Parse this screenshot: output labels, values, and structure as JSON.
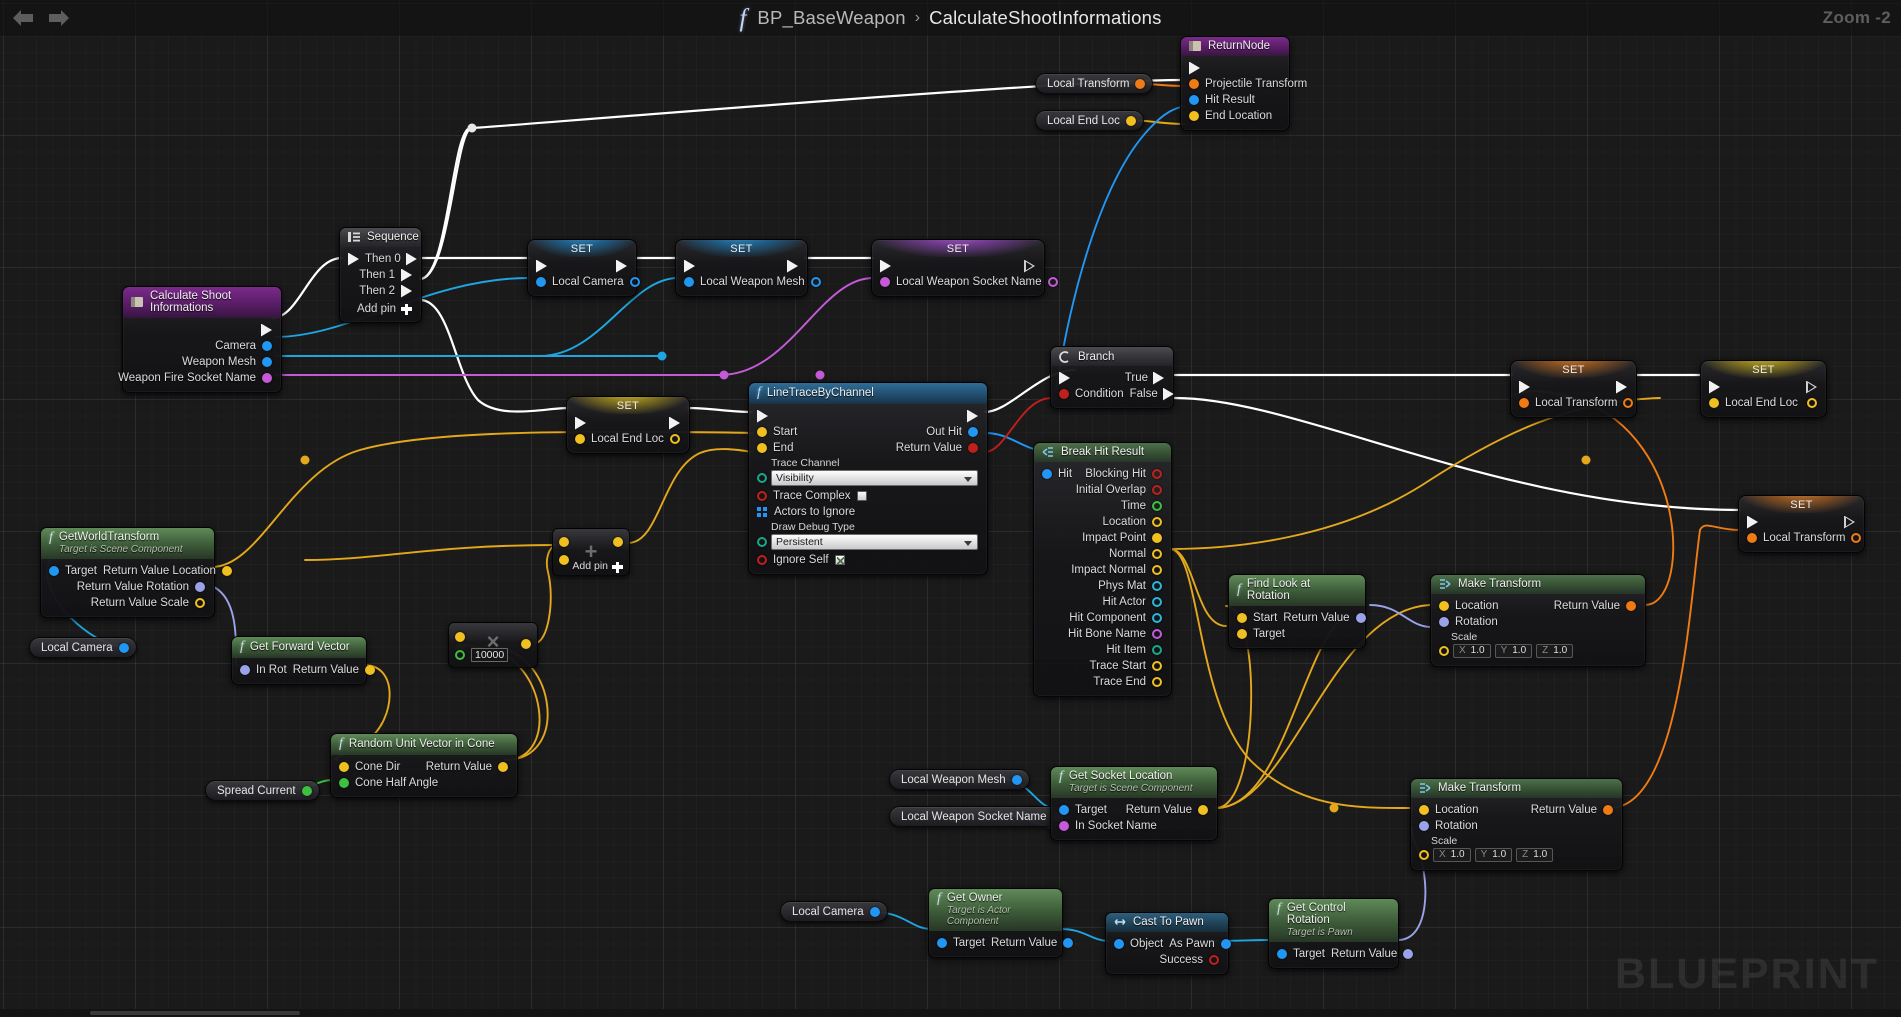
{
  "toolbar": {
    "back_icon": "arrow-left-icon",
    "forward_icon": "arrow-right-icon",
    "function_glyph": "f",
    "blueprint_name": "BP_BaseWeapon",
    "separator": "›",
    "function_name": "CalculateShootInformations",
    "zoom_label": "Zoom -2"
  },
  "watermark": "BLUEPRINT",
  "nodes": {
    "entry": {
      "title": "Calculate Shoot Informations",
      "pins": [
        "Camera",
        "Weapon Mesh",
        "Weapon Fire Socket Name"
      ]
    },
    "sequence": {
      "title": "Sequence",
      "outputs": [
        "Then 0",
        "Then 1",
        "Then 2"
      ],
      "add_pin": "Add pin"
    },
    "set_local_camera": {
      "title": "SET",
      "pin": "Local Camera"
    },
    "set_local_weapon_mesh": {
      "title": "SET",
      "pin": "Local Weapon Mesh"
    },
    "set_local_weapon_socket_name": {
      "title": "SET",
      "pin": "Local Weapon Socket Name"
    },
    "set_local_end_loc_mid": {
      "title": "SET",
      "pin": "Local End Loc"
    },
    "set_local_transform_r1": {
      "title": "SET",
      "pin": "Local Transform"
    },
    "set_local_end_loc_r1": {
      "title": "SET",
      "pin": "Local End Loc"
    },
    "set_local_transform_r2": {
      "title": "SET",
      "pin": "Local Transform"
    },
    "return_node": {
      "title": "ReturnNode",
      "pins": [
        "Projectile Transform",
        "Hit Result",
        "End Location"
      ]
    },
    "line_trace": {
      "title": "LineTraceByChannel",
      "inputs": [
        "Start",
        "End"
      ],
      "outputs": [
        "Out Hit",
        "Return Value"
      ],
      "trace_channel_label": "Trace Channel",
      "trace_channel_value": "Visibility",
      "trace_complex_label": "Trace Complex",
      "trace_complex_checked": false,
      "actors_to_ignore_label": "Actors to Ignore",
      "draw_debug_label": "Draw Debug Type",
      "draw_debug_value": "Persistent",
      "ignore_self_label": "Ignore Self",
      "ignore_self_checked": true
    },
    "branch": {
      "title": "Branch",
      "condition": "Condition",
      "true_label": "True",
      "false_label": "False"
    },
    "break_hit_result": {
      "title": "Break Hit Result",
      "input": "Hit",
      "outputs": [
        "Blocking Hit",
        "Initial Overlap",
        "Time",
        "Location",
        "Impact Point",
        "Normal",
        "Impact Normal",
        "Phys Mat",
        "Hit Actor",
        "Hit Component",
        "Hit Bone Name",
        "Hit Item",
        "Trace Start",
        "Trace End"
      ]
    },
    "get_world_transform": {
      "title": "GetWorldTransform",
      "subtitle": "Target is Scene Component",
      "input": "Target",
      "outputs": [
        "Return Value Location",
        "Return Value Rotation",
        "Return Value Scale"
      ]
    },
    "get_forward_vector": {
      "title": "Get Forward Vector",
      "input": "In Rot",
      "output": "Return Value"
    },
    "random_unit_vector_in_cone": {
      "title": "Random Unit Vector in Cone",
      "inputs": [
        "Cone Dir",
        "Cone Half Angle"
      ],
      "output": "Return Value"
    },
    "multiply": {
      "glyph": "×",
      "value": "10000"
    },
    "add_vector": {
      "add_pin": "Add pin",
      "glyph": "+"
    },
    "find_look_at_rotation": {
      "title": "Find Look at Rotation",
      "inputs": [
        "Start",
        "Target"
      ],
      "output": "Return Value"
    },
    "make_transform_top": {
      "title": "Make Transform",
      "inputs": [
        "Location",
        "Rotation"
      ],
      "scale_label": "Scale",
      "scale": {
        "x": "1.0",
        "y": "1.0",
        "z": "1.0"
      },
      "output": "Return Value"
    },
    "make_transform_bottom": {
      "title": "Make Transform",
      "inputs": [
        "Location",
        "Rotation"
      ],
      "scale_label": "Scale",
      "scale": {
        "x": "1.0",
        "y": "1.0",
        "z": "1.0"
      },
      "output": "Return Value"
    },
    "get_socket_location": {
      "title": "Get Socket Location",
      "subtitle": "Target is Scene Component",
      "inputs": [
        "Target",
        "In Socket Name"
      ],
      "output": "Return Value"
    },
    "get_owner": {
      "title": "Get Owner",
      "subtitle": "Target is Actor Component",
      "input": "Target",
      "output": "Return Value"
    },
    "cast_to_pawn": {
      "title": "Cast To Pawn",
      "input": "Object",
      "outputs": [
        "As Pawn",
        "Success"
      ]
    },
    "get_control_rotation": {
      "title": "Get Control Rotation",
      "subtitle": "Target is Pawn",
      "input": "Target",
      "output": "Return Value"
    },
    "axis_labels": {
      "x": "X",
      "y": "Y",
      "z": "Z"
    }
  },
  "variables": {
    "local_transform_a": "Local Transform",
    "local_end_loc_a": "Local End Loc",
    "local_camera_a": "Local Camera",
    "spread_current": "Spread Current",
    "local_weapon_mesh_b": "Local Weapon Mesh",
    "local_weapon_socket_name_b": "Local Weapon Socket Name",
    "local_camera_b": "Local Camera"
  },
  "colors": {
    "exec_wire": "#ffffff",
    "object_wire": "#1fa5e0",
    "vector_wire": "#e3a81c",
    "transform_wire": "#f07b14",
    "rotator_wire": "#9aa3e8",
    "name_wire": "#c45ad8",
    "struct_wire": "#2196f3",
    "float_wire": "#3fbf3f",
    "bool_wire": "#c0201c"
  }
}
